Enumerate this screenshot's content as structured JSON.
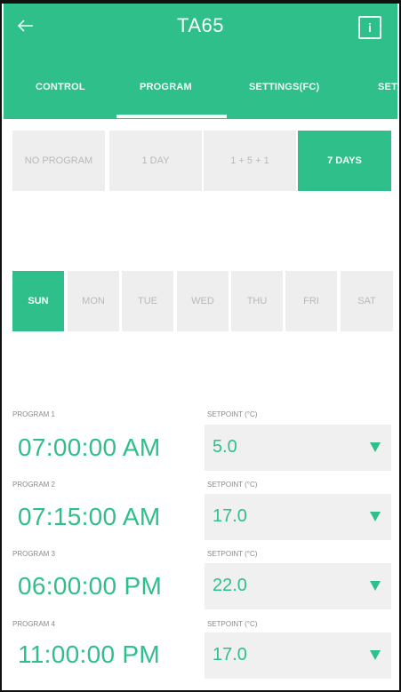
{
  "header": {
    "title": "TA65",
    "back_icon": "arrow-left-icon",
    "info_icon": "info-icon",
    "accent": "#2fbf8a"
  },
  "tabs": [
    {
      "label": "CONTROL"
    },
    {
      "label": "PROGRAM",
      "selected": true
    },
    {
      "label": "SETTINGS(FC)"
    },
    {
      "label": "SET"
    }
  ],
  "modes": [
    {
      "label": "NO PROGRAM"
    },
    {
      "label": "1 DAY"
    },
    {
      "label": "1 + 5 + 1"
    },
    {
      "label": "7 DAYS",
      "selected": true
    }
  ],
  "days": [
    {
      "label": "SUN",
      "selected": true
    },
    {
      "label": "MON"
    },
    {
      "label": "TUE"
    },
    {
      "label": "WED"
    },
    {
      "label": "THU"
    },
    {
      "label": "FRI"
    },
    {
      "label": "SAT"
    }
  ],
  "programs": [
    {
      "label": "PROGRAM 1",
      "time": "07:00:00 AM",
      "setpoint_label": "SETPOINT (°C)",
      "setpoint": "5.0"
    },
    {
      "label": "PROGRAM 2",
      "time": "07:15:00 AM",
      "setpoint_label": "SETPOINT (°C)",
      "setpoint": "17.0"
    },
    {
      "label": "PROGRAM 3",
      "time": "06:00:00 PM",
      "setpoint_label": "SETPOINT (°C)",
      "setpoint": "22.0"
    },
    {
      "label": "PROGRAM 4",
      "time": "11:00:00 PM",
      "setpoint_label": "SETPOINT (°C)",
      "setpoint": "17.0"
    }
  ]
}
